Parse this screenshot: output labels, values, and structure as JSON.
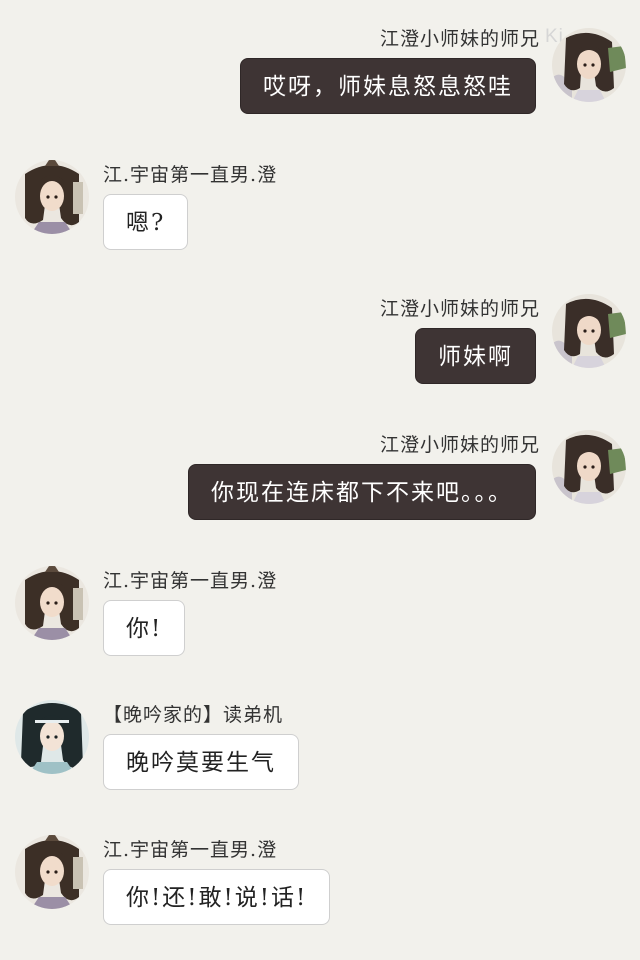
{
  "watermark": "Ki...a",
  "messages": [
    {
      "side": "right",
      "avatar": "jiang-cheng-sister-avatar",
      "sender": "江澄小师妹的师兄",
      "text": "哎呀，师妹息怒息怒哇"
    },
    {
      "side": "left",
      "avatar": "jiang-cheng-avatar",
      "sender": "江.宇宙第一直男.澄",
      "text": "嗯?"
    },
    {
      "side": "right",
      "avatar": "jiang-cheng-sister-avatar",
      "sender": "江澄小师妹的师兄",
      "text": "师妹啊"
    },
    {
      "side": "right",
      "avatar": "jiang-cheng-sister-avatar",
      "sender": "江澄小师妹的师兄",
      "text": "你现在连床都下不来吧。。。"
    },
    {
      "side": "left",
      "avatar": "jiang-cheng-avatar",
      "sender": "江.宇宙第一直男.澄",
      "text": "你!"
    },
    {
      "side": "left",
      "avatar": "lan-xichen-avatar",
      "sender": "【晚吟家的】读弟机",
      "text": "晚吟莫要生气"
    },
    {
      "side": "left",
      "avatar": "jiang-cheng-avatar",
      "sender": "江.宇宙第一直男.澄",
      "text": "你!还!敢!说!话!"
    }
  ],
  "colors": {
    "background": "#f2f1ec",
    "bubble_right": "#3e3434",
    "bubble_left": "#ffffff"
  }
}
